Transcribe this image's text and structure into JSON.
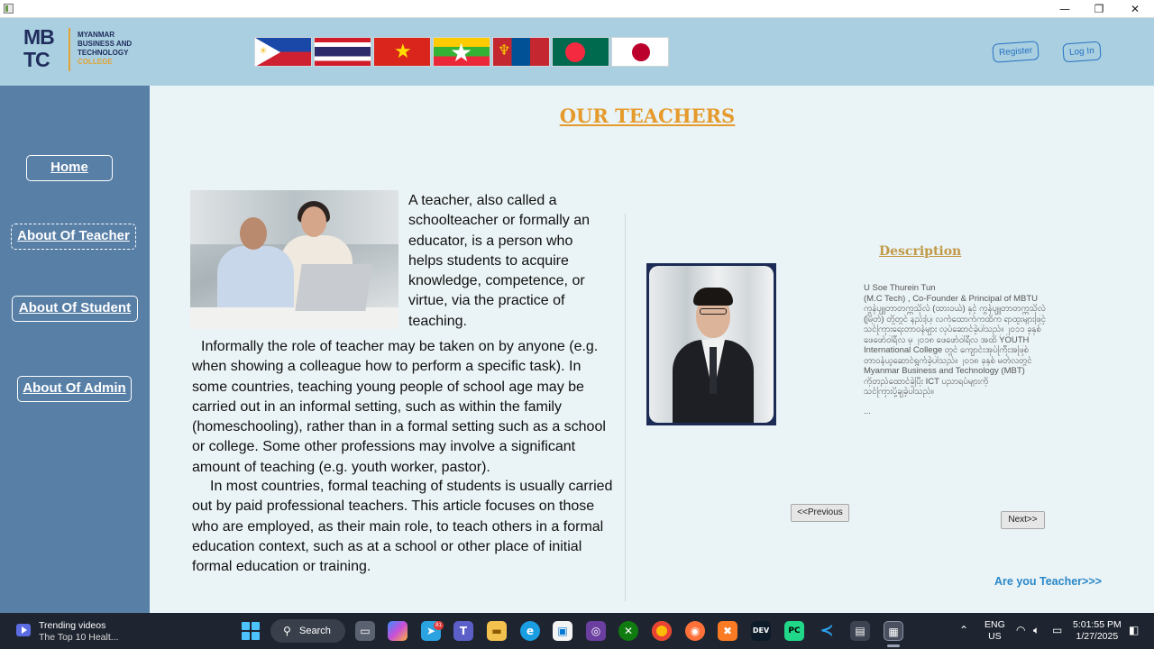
{
  "window": {
    "minimize_glyph": "—",
    "maximize_glyph": "❐",
    "close_glyph": "✕"
  },
  "header": {
    "logo": {
      "mark": "MBTC",
      "line1": "MYANMAR",
      "line2": "BUSINESS AND",
      "line3": "TECHNOLOGY",
      "line4": "COLLEGE"
    },
    "flags": [
      "philippines-flag",
      "thailand-flag",
      "vietnam-flag",
      "myanmar-flag",
      "mongolia-flag",
      "bangladesh-flag",
      "japan-flag"
    ],
    "register_label": "Register",
    "login_label": "Log In"
  },
  "sidebar": {
    "items": [
      {
        "label": "Home",
        "active": false
      },
      {
        "label": "About Of Teacher",
        "active": true
      },
      {
        "label": "About Of Student",
        "active": false
      },
      {
        "label": "About Of Admin",
        "active": false
      }
    ]
  },
  "main": {
    "title": "OUR TEACHERS",
    "intro": "A teacher, also called a schoolteacher or formally an educator, is a person who helps students to acquire knowledge, competence, or virtue, via the practice of teaching.",
    "para2": "Informally the role of teacher may be taken on by anyone (e.g. when showing a colleague how to perform a specific task). In some countries, teaching young people of school age may be carried out in an informal setting, such as within the family (homeschooling), rather than in a formal setting such as a school or college. Some other professions may involve a significant amount of teaching (e.g. youth worker, pastor).",
    "para3": "In most countries, formal teaching of students is usually carried out by paid professional teachers. This article focuses on those who are employed, as their main role, to teach others in a formal education context, such as at a school or other place of initial formal education or training.",
    "profile": {
      "description_title": "Description",
      "name": "U Soe Thurein Tun",
      "role": "(M.C Tech) , Co-Founder & Principal of MBTU",
      "bio_lines": [
        "ကွန်ပျူတာတက္ကသိုလ် (ထားဝယ်) နှင့် ကွန်ပျူတာတက္ကသိုလ်",
        "(မြိတ်) တို့တွင် နည်းပြ၊ လက်ထောက်ကထိက ရာထူးများဖြင့်",
        "သင်ကြားရေးတာဝန်များ လုပ်ဆောင်ခဲ့ပါသည်။ ၂၀၁၁ ခုနှစ်",
        "ဖေဖော်ဝါရီလ မှ ၂၀၁၈ ဖေဖော်ဝါရီလ အထိ YOUTH",
        "International College တွင် ကျောင်းအုပ်ကြီးအဖြစ်",
        "တာဝန်ယူဆောင်ရွက်ခဲ့ပါသည်။ ၂၀၁၈ ခုနှစ် မတ်လတွင်",
        "Myanmar Business and Technology (MBT)",
        "ကိုတည်ထောင်ခဲ့ပြီး ICT ပညာရပ်များကို",
        "သင်ကြားပို့ချခဲ့ပါသည်။"
      ],
      "ellipsis": "..."
    },
    "prev_label": "<<Previous",
    "next_label": "Next>>",
    "cta_label": "Are you Teacher>>>"
  },
  "taskbar": {
    "widget_title": "Trending videos",
    "widget_subtitle": "The Top 10 Healt...",
    "search_label": "Search",
    "search_icon": "search-icon",
    "badge_count": "81",
    "lang_line1": "ENG",
    "lang_line2": "US",
    "time": "5:01:55 PM",
    "date": "1/27/2025"
  }
}
